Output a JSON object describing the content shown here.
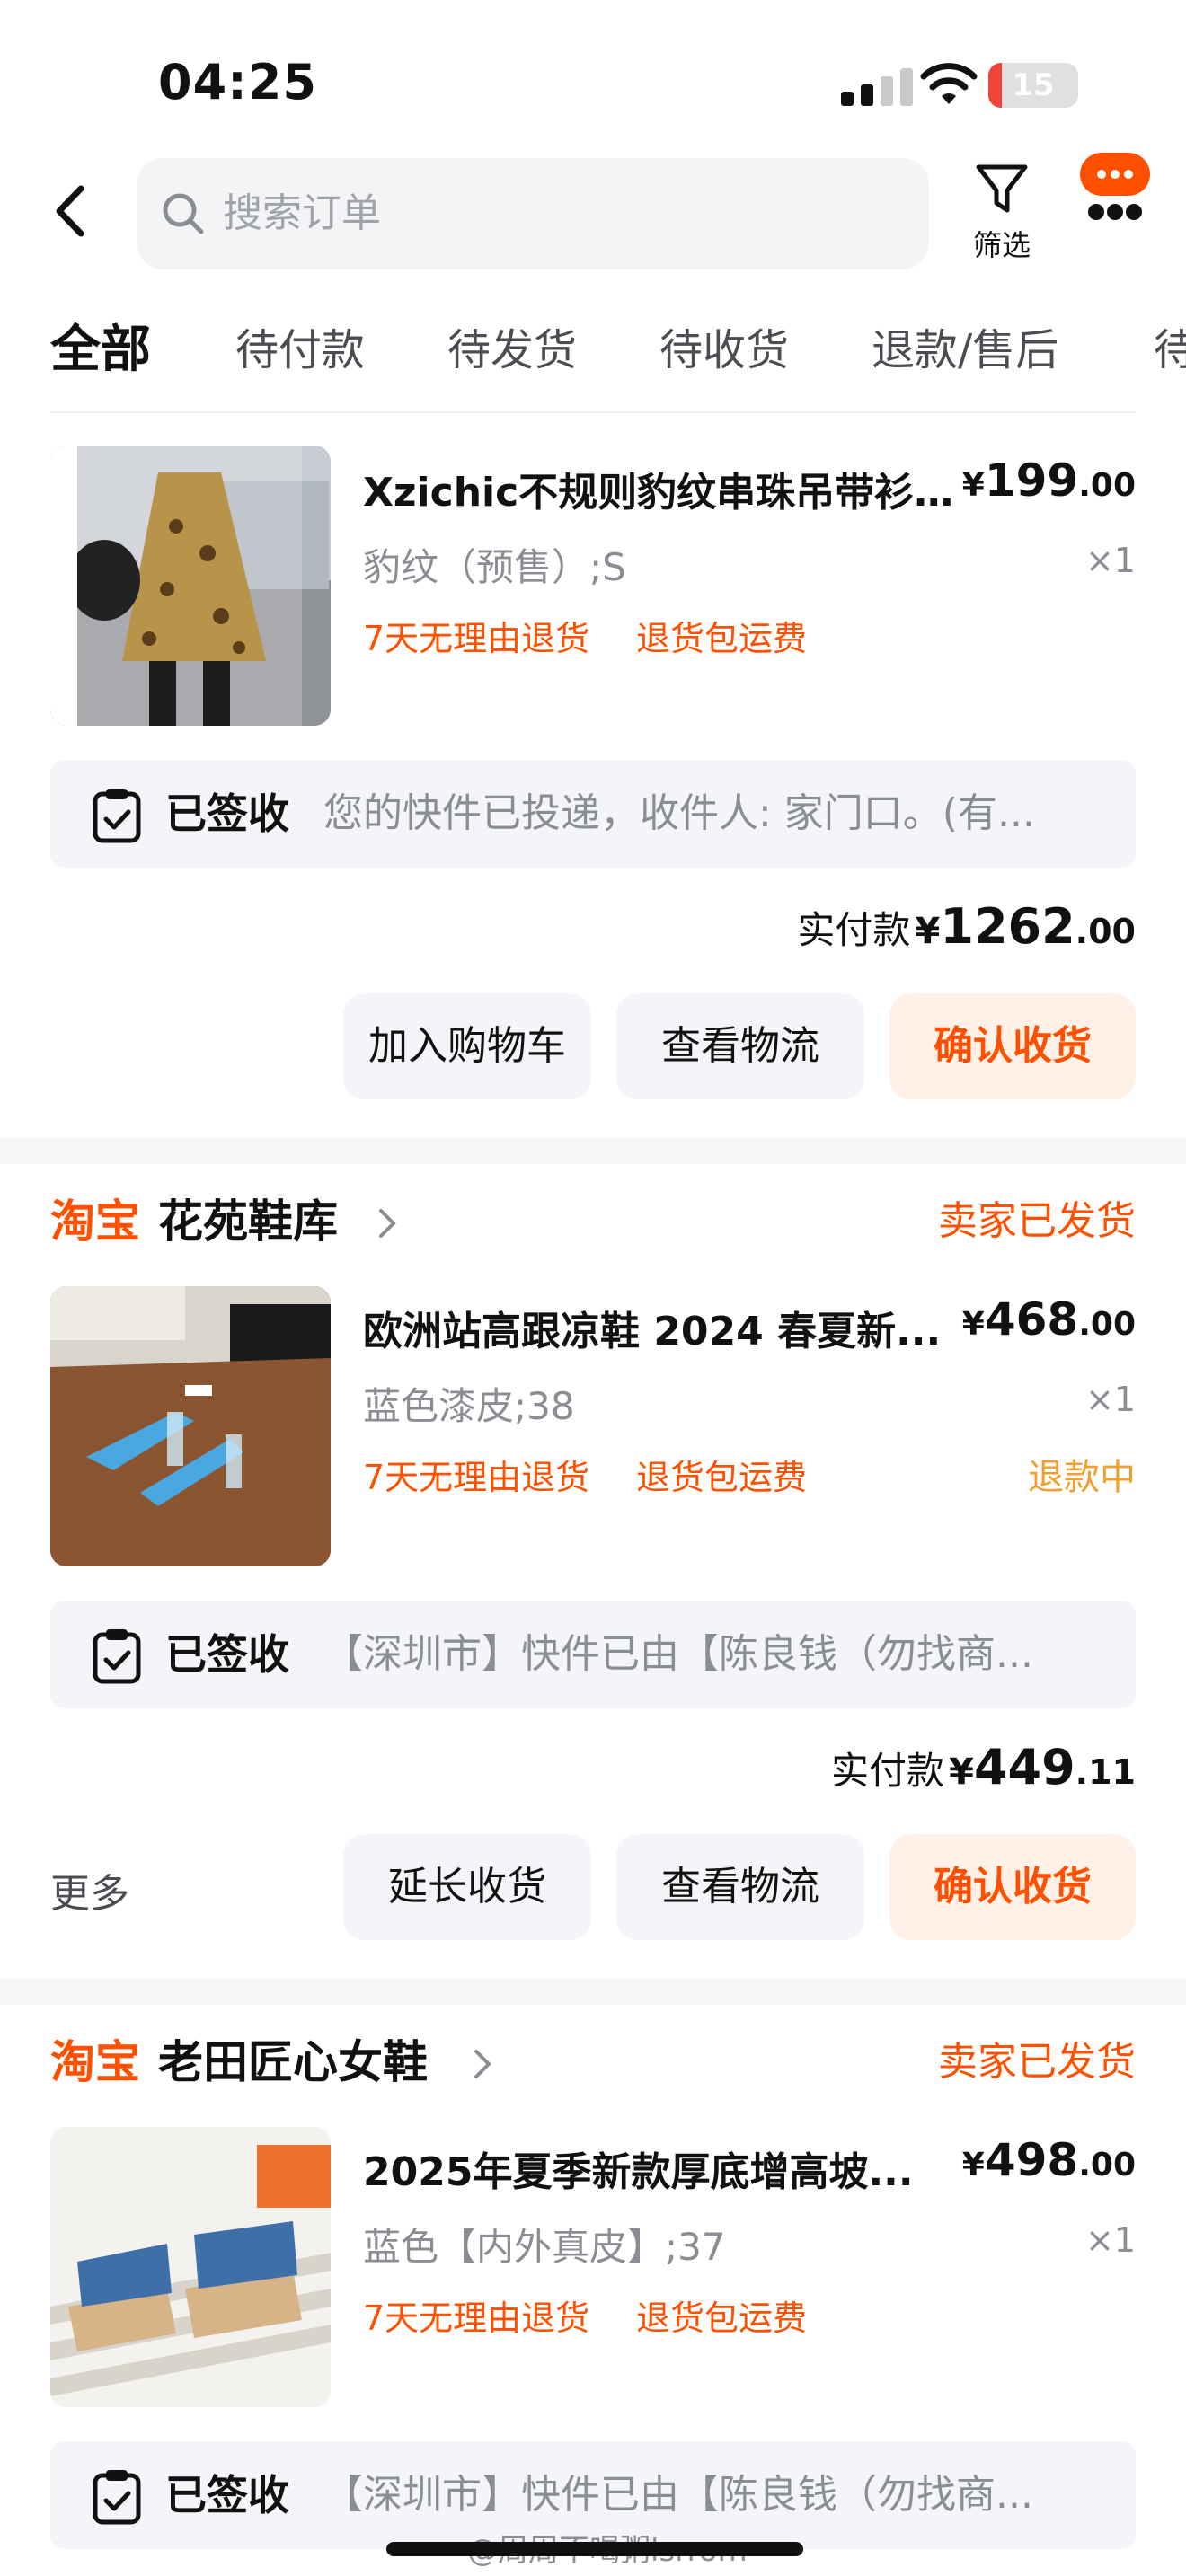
{
  "status_bar": {
    "time": "04:25",
    "battery": "15",
    "battery_level": 0.15
  },
  "header": {
    "search_placeholder": "搜索订单",
    "filter_label": "筛选",
    "icons": {
      "back": "chevron-left-icon",
      "search": "search-icon",
      "filter": "filter-funnel-icon",
      "messages": "chat-bubble-icon"
    }
  },
  "tabs": [
    {
      "label": "全部",
      "active": true
    },
    {
      "label": "待付款"
    },
    {
      "label": "待发货"
    },
    {
      "label": "待收货"
    },
    {
      "label": "退款/售后"
    },
    {
      "label": "待"
    }
  ],
  "colors": {
    "accent": "#ff5000",
    "refund": "#f0a030",
    "muted": "#8a8d93"
  },
  "orders": [
    {
      "product": {
        "title": "Xzichic不规则豹纹串珠吊带衫...",
        "price_currency": "¥",
        "price_int": "199",
        "price_dec": ".00",
        "sku": "豹纹（预售）;S",
        "qty": "×1",
        "tags": [
          "7天无理由退货",
          "退货包运费"
        ]
      },
      "logistics": {
        "status": "已签收",
        "text": "您的快件已投递，收件人: 家门口。(有..."
      },
      "paid": {
        "label": "实付款",
        "currency": "¥",
        "int": "1262",
        "dec": ".00"
      },
      "buttons": [
        "加入购物车",
        "查看物流",
        "确认收货"
      ]
    },
    {
      "shop": {
        "brand": "淘宝",
        "name": "花苑鞋库",
        "status": "卖家已发货"
      },
      "product": {
        "title": "欧洲站高跟凉鞋 2024 春夏新...",
        "price_currency": "¥",
        "price_int": "468",
        "price_dec": ".00",
        "sku": "蓝色漆皮;38",
        "qty": "×1",
        "tags": [
          "7天无理由退货",
          "退货包运费"
        ],
        "refund_status": "退款中"
      },
      "logistics": {
        "status": "已签收",
        "text": "【深圳市】快件已由【陈良钱（勿找商..."
      },
      "paid": {
        "label": "实付款",
        "currency": "¥",
        "int": "449",
        "dec": ".11"
      },
      "more": "更多",
      "buttons": [
        "延长收货",
        "查看物流",
        "确认收货"
      ]
    },
    {
      "shop": {
        "brand": "淘宝",
        "name": "老田匠心女鞋",
        "status": "卖家已发货"
      },
      "product": {
        "title": "2025年夏季新款厚底增高坡...",
        "price_currency": "¥",
        "price_int": "498",
        "price_dec": ".00",
        "sku": "蓝色【内外真皮】;37",
        "qty": "×1",
        "tags": [
          "7天无理由退货",
          "退货包运费"
        ]
      },
      "logistics": {
        "status": "已签收",
        "text": "【深圳市】快件已由【陈良钱（勿找商..."
      }
    }
  ],
  "watermark": "@周周不喝粥lsrrom"
}
